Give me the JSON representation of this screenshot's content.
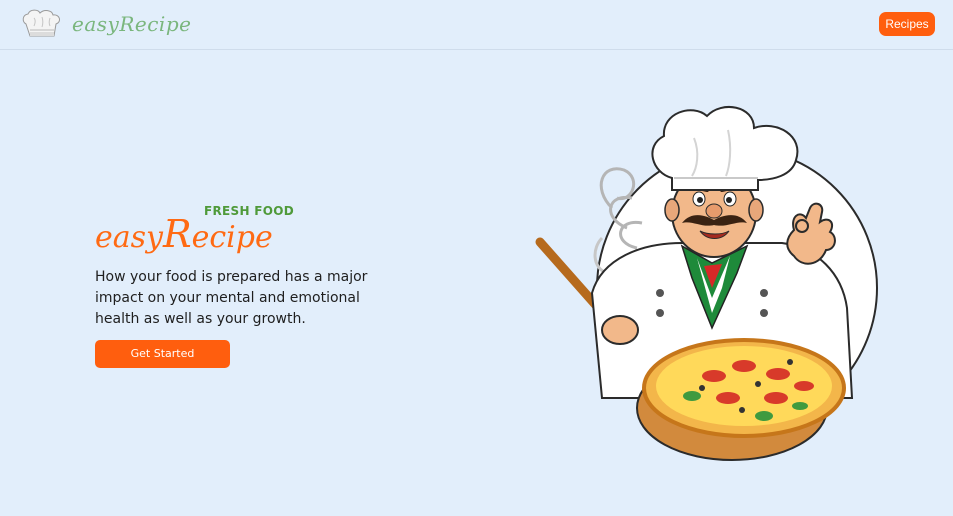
{
  "navbar": {
    "brand_text": "easyRecipe",
    "logo_icon": "chef-hat-icon",
    "recipes_label": "Recipes"
  },
  "hero": {
    "tagline": "FRESH FOOD",
    "title_part1": "easy",
    "title_cap": "R",
    "title_part2": "ecipe",
    "description": "How your food is prepared has a major impact on your mental and emotional health as well as your growth.",
    "cta_label": "Get Started",
    "illustration": "chef-with-pizza-illustration"
  },
  "colors": {
    "background": "#e2eefb",
    "accent": "#ff5e0e",
    "brand_green": "#7ab67d",
    "tagline_green": "#4f9a3a"
  }
}
